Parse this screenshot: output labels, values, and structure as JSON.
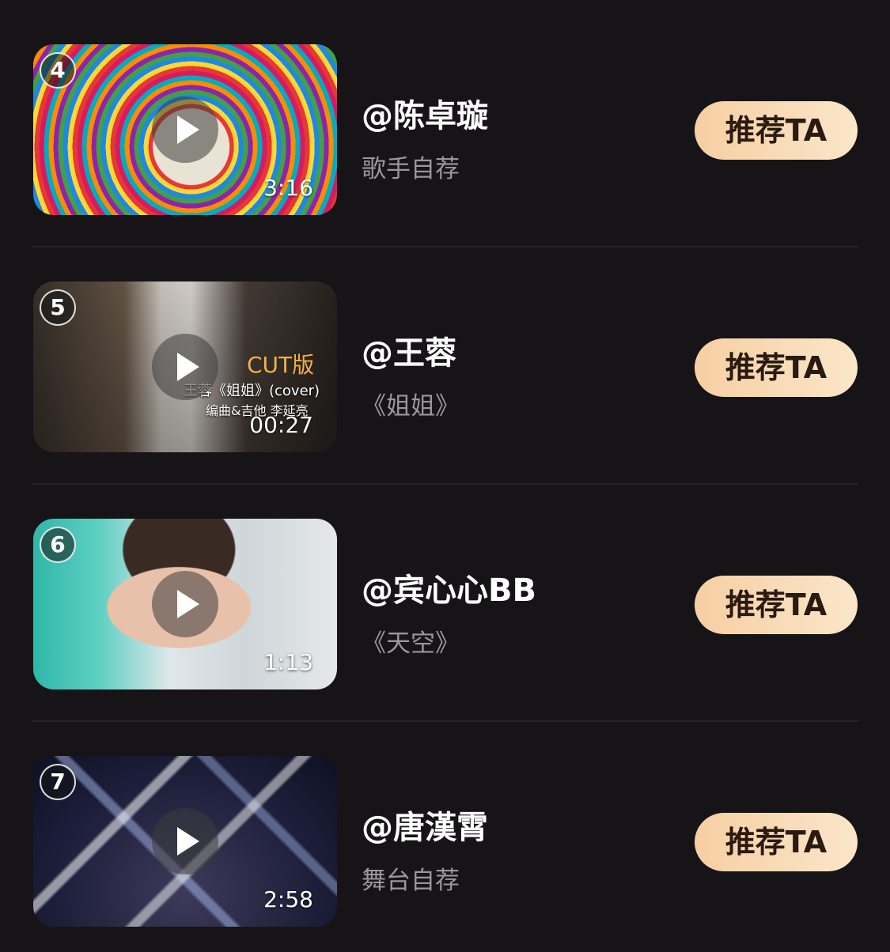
{
  "items": [
    {
      "rank": "4",
      "name": "@陈卓璇",
      "desc": "歌手自荐",
      "duration": "3:16",
      "button": "推荐TA"
    },
    {
      "rank": "5",
      "name": "@王蓉",
      "desc": "《姐姐》",
      "duration": "00:27",
      "button": "推荐TA",
      "thumb_overlay": {
        "cut": "CUT版",
        "caption": "王蓉《姐姐》(cover)",
        "credits": "编曲&吉他 李延亮"
      }
    },
    {
      "rank": "6",
      "name": "@宾心心BB",
      "desc": "《天空》",
      "duration": "1:13",
      "button": "推荐TA"
    },
    {
      "rank": "7",
      "name": "@唐漢霄",
      "desc": "舞台自荐",
      "duration": "2:58",
      "button": "推荐TA"
    }
  ],
  "colors": {
    "background": "#161416",
    "button_gradient_start": "#f6cfa3",
    "button_gradient_end": "#fbe6c9",
    "button_text": "#2a1a10",
    "desc_text": "#9a9799"
  },
  "icons": {
    "play": "play-icon"
  }
}
